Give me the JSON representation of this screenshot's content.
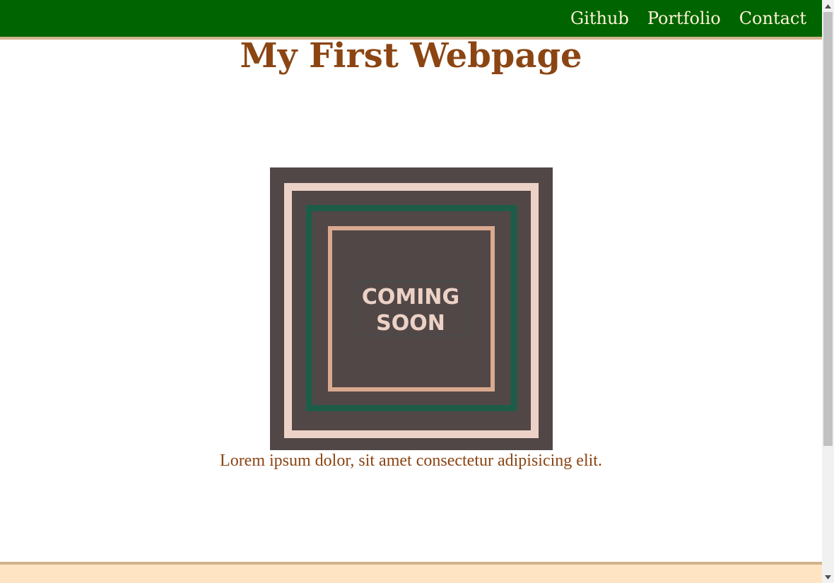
{
  "nav": {
    "links": [
      "Github",
      "Portfolio",
      "Contact"
    ]
  },
  "page_title": "My First Webpage",
  "hero_image": {
    "text_line_1": "COMING",
    "text_line_2": "SOON"
  },
  "lead_text": "Lorem ipsum dolor, sit amet consectetur adipisicing elit.",
  "colors": {
    "nav_bg": "#006400",
    "accent_border": "#d2b48c",
    "title": "#8b4513",
    "footer_bg": "#ffe4c4",
    "image_bg": "#524747",
    "image_frame_light": "#ecd2c6",
    "image_frame_green": "#1e5c4a",
    "image_frame_peach": "#d9a98f"
  }
}
